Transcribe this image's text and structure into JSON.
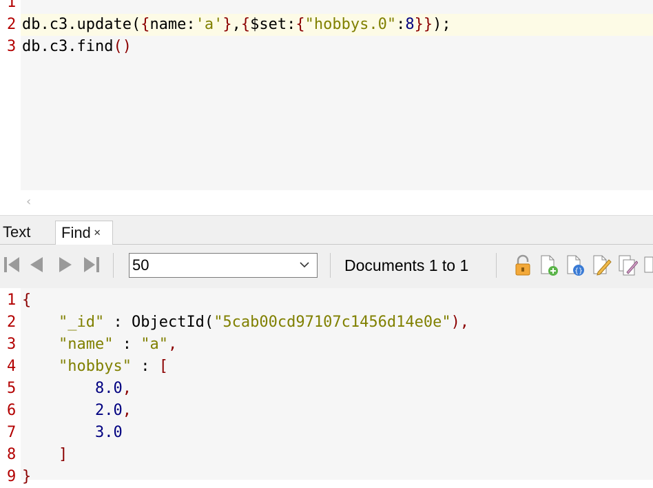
{
  "editor": {
    "line_numbers": [
      "1",
      "2",
      "3"
    ],
    "line2": {
      "p1": "db.c3.update(",
      "p2": "{",
      "p3": "name:",
      "p4": "'a'",
      "p5": "}",
      "p6": ",",
      "p7": "{",
      "p8": "$set:",
      "p9": "{",
      "p10": "\"hobbys.0\"",
      "p11": ":",
      "p12": "8",
      "p13": "}}",
      "p14": ")",
      "p15": ";"
    },
    "line3": {
      "p1": "db.c3.find",
      "p2": "()"
    },
    "scroll_left_arrow": "‹"
  },
  "tabs": [
    {
      "label": "Text"
    },
    {
      "label": "Find",
      "close": "✕"
    }
  ],
  "toolbar": {
    "page_size_value": "50",
    "documents_label": "Documents 1 to 1",
    "icons": [
      "first-page-icon",
      "prev-page-icon",
      "next-page-icon",
      "last-page-icon",
      "lock-icon",
      "new-document-icon",
      "view-json-icon",
      "edit-document-icon",
      "copy-document-icon"
    ]
  },
  "results": {
    "line_numbers": [
      "1",
      "2",
      "3",
      "4",
      "5",
      "6",
      "7",
      "8",
      "9"
    ],
    "open_brace": "{",
    "id_key": "\"_id\"",
    "colon": " : ",
    "objectid_fn": "ObjectId(",
    "objectid_val": "\"5cab00cd97107c1456d14e0e\"",
    "objectid_close": "),",
    "name_key": "\"name\"",
    "name_val": "\"a\"",
    "comma": ",",
    "hobbys_key": "\"hobbys\"",
    "open_bracket": "[",
    "h1": "8.0",
    "h2": "2.0",
    "h3": "3.0",
    "close_bracket": "]",
    "close_brace": "}"
  },
  "colors": {
    "line_number": "#b30000",
    "string": "#808000",
    "number": "#000080",
    "bracket": "#8b0000"
  }
}
